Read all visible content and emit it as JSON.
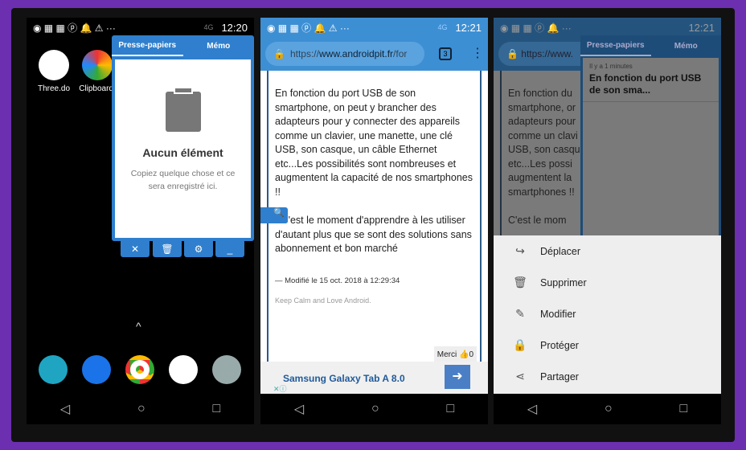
{
  "colors": {
    "background": "#6b2fb0",
    "accent": "#2f7fce",
    "chrome": "#3d8fd4"
  },
  "screen1": {
    "time": "12:20",
    "network": "4G",
    "apps": [
      {
        "label": "Three.do"
      },
      {
        "label": "Clipboard."
      }
    ],
    "clipboard": {
      "tabs": [
        "Presse-papiers",
        "Mémo"
      ],
      "empty_title": "Aucun élément",
      "empty_text": "Copiez quelque chose et ce sera enregistré ici.",
      "tools": [
        "close-icon",
        "trash-icon",
        "gear-icon",
        "minimize-icon"
      ]
    },
    "dock": [
      "phone-icon",
      "messages-icon",
      "chrome-icon",
      "photos-icon",
      "camera-icon"
    ]
  },
  "screen2": {
    "time": "12:21",
    "network": "4G",
    "url_prefix": "https://",
    "url_domain": "www.androidpit.fr",
    "url_suffix": "/for",
    "tab_count": "3",
    "paragraph1": "En fonction du port USB de son smartphone, on peut y brancher des adapteurs pour y connecter des appareils comme un clavier, une manette, une clé USB, son casque, un câble Ethernet etc...Les possibilités sont nombreuses et augmentent la capacité de nos smartphones !!",
    "paragraph2": "C'est le moment d'apprendre à les utiliser d'autant plus que se sont des solutions sans abonnement et bon marché",
    "modified": "— Modifié le 15 oct. 2018 à 12:29:34",
    "signature": "Keep Calm and Love Android.",
    "thanks_label": "Merci",
    "thanks_count": "0",
    "ad_text": "Samsung Galaxy Tab A 8.0"
  },
  "screen3": {
    "time": "12:21",
    "tabs": [
      "Presse-papiers",
      "Mémo"
    ],
    "clip_time": "Il y a 1 minutes",
    "clip_text": "En fonction du port USB de son sma...",
    "bg_text": "En fonction du smartphone, or adapteurs pour comme un clavi USB, son casqu etc...Les possi augmentent la smartphones !!",
    "bg_text2": "C'est le mom",
    "actions": [
      {
        "label": "Déplacer",
        "icon": "share-arrow-icon"
      },
      {
        "label": "Supprimer",
        "icon": "trash-icon"
      },
      {
        "label": "Modifier",
        "icon": "pencil-icon"
      },
      {
        "label": "Protéger",
        "icon": "lock-icon"
      },
      {
        "label": "Partager",
        "icon": "share-icon"
      }
    ]
  }
}
